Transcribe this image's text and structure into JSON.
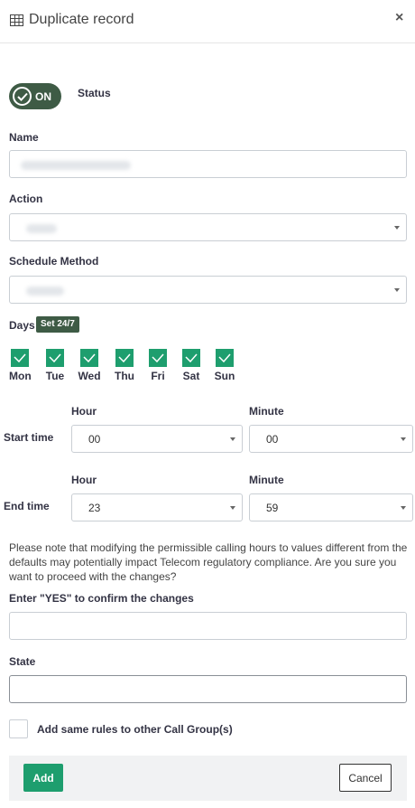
{
  "header": {
    "title": "Duplicate record",
    "close_label": "×"
  },
  "status": {
    "toggle_label": "ON",
    "label": "Status"
  },
  "name": {
    "label": "Name"
  },
  "action": {
    "label": "Action"
  },
  "schedule_method": {
    "label": "Schedule Method"
  },
  "days": {
    "label": "Days",
    "set_24_7_label": "Set 24/7",
    "items": [
      {
        "label": "Mon",
        "checked": true
      },
      {
        "label": "Tue",
        "checked": true
      },
      {
        "label": "Wed",
        "checked": true
      },
      {
        "label": "Thu",
        "checked": true
      },
      {
        "label": "Fri",
        "checked": true
      },
      {
        "label": "Sat",
        "checked": true
      },
      {
        "label": "Sun",
        "checked": true
      }
    ]
  },
  "start_time": {
    "label": "Start time",
    "hour_label": "Hour",
    "minute_label": "Minute",
    "hour": "00",
    "minute": "00"
  },
  "end_time": {
    "label": "End time",
    "hour_label": "Hour",
    "minute_label": "Minute",
    "hour": "23",
    "minute": "59"
  },
  "compliance_note": "Please note that modifying the permissible calling hours to values different from the defaults may potentially impact Telecom regulatory compliance. Are you sure you want to proceed with the changes?",
  "confirm": {
    "label": "Enter \"YES\" to confirm the changes"
  },
  "state": {
    "label": "State"
  },
  "add_same_rules": {
    "label": "Add same rules to other Call Group(s)"
  },
  "footer": {
    "add_label": "Add",
    "cancel_label": "Cancel"
  },
  "colors": {
    "accent_green": "#1e9e6e",
    "dark_green": "#3e5b45"
  }
}
